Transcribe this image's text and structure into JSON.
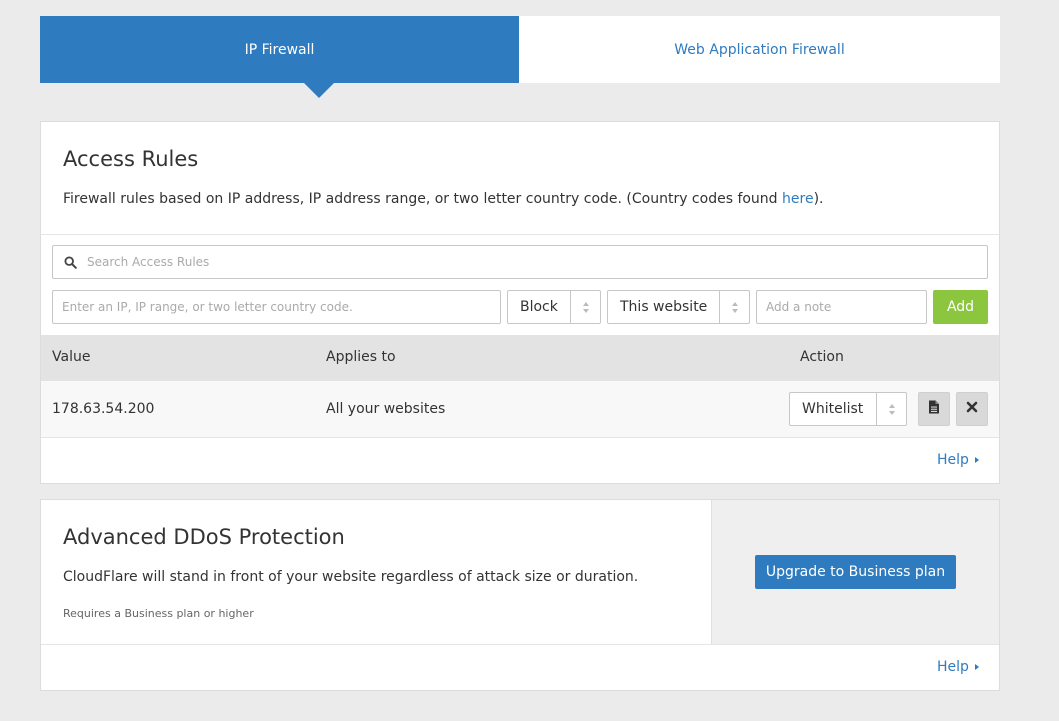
{
  "tabs": [
    {
      "label": "IP Firewall",
      "active": true
    },
    {
      "label": "Web Application Firewall",
      "active": false
    }
  ],
  "access_rules": {
    "title": "Access Rules",
    "description_prefix": "Firewall rules based on IP address, IP address range, or two letter country code. (Country codes found ",
    "description_link": "here",
    "description_suffix": ").",
    "search_placeholder": "Search Access Rules",
    "ip_placeholder": "Enter an IP, IP range, or two letter country code.",
    "mode_select": "Block",
    "scope_select": "This website",
    "note_placeholder": "Add a note",
    "add_label": "Add",
    "columns": {
      "value": "Value",
      "applies_to": "Applies to",
      "action": "Action"
    },
    "rows": [
      {
        "value": "178.63.54.200",
        "applies_to": "All your websites",
        "action": "Whitelist"
      }
    ],
    "help_label": "Help"
  },
  "ddos": {
    "title": "Advanced DDoS Protection",
    "description": "CloudFlare will stand in front of your website regardless of attack size or duration.",
    "requirement": "Requires a Business plan or higher",
    "upgrade_label": "Upgrade to Business plan",
    "help_label": "Help"
  },
  "colors": {
    "primary": "#2f7bbf",
    "add_button": "#8cc63f",
    "background": "#ebebeb"
  }
}
